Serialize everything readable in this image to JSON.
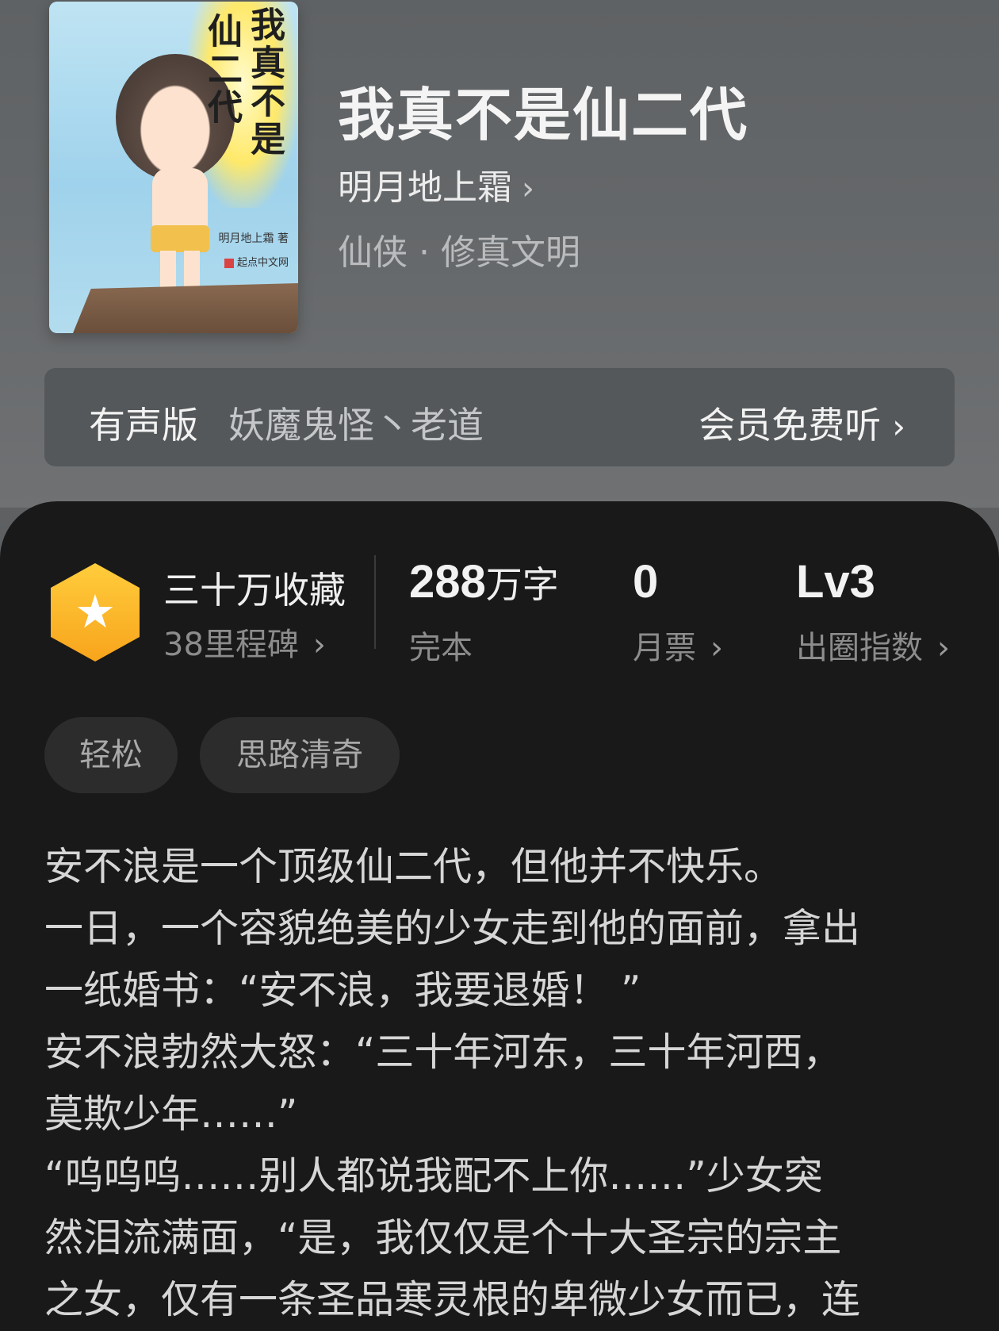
{
  "book": {
    "cover_title_col1": "我真不是",
    "cover_title_col2": "仙二代",
    "cover_author_mark": "明月地上霜 著",
    "cover_publisher_mark": "起点中文网",
    "title": "我真不是仙二代",
    "author": "明月地上霜",
    "genre": "仙侠 · 修真文明"
  },
  "audio": {
    "label": "有声版",
    "narrators": "妖魔鬼怪丶老道",
    "cta": "会员免费听"
  },
  "stats": {
    "collection": {
      "title": "三十万收藏",
      "sub": "38里程碑"
    },
    "words": {
      "number": "288",
      "unit": "万字",
      "sub": "完本"
    },
    "monthly_ticket": {
      "number": "0",
      "sub": "月票"
    },
    "popularity": {
      "number": "Lv3",
      "sub": "出圈指数"
    }
  },
  "tags": [
    "轻松",
    "思路清奇"
  ],
  "synopsis": [
    "安不浪是一个顶级仙二代，但他并不快乐。",
    "一日，一个容貌绝美的少女走到他的面前，拿出",
    "一纸婚书：“安不浪，我要退婚！ ”",
    "安不浪勃然大怒：“三十年河东，三十年河西，",
    "莫欺少年……”",
    "“呜呜呜……别人都说我配不上你……”少女突",
    "然泪流满面，“是，我仅仅是个十大圣宗的宗主",
    "之女，仅有一条圣品寒灵根的卑微少女而已，连"
  ],
  "icons": {
    "chevron": "›",
    "star": "★"
  }
}
